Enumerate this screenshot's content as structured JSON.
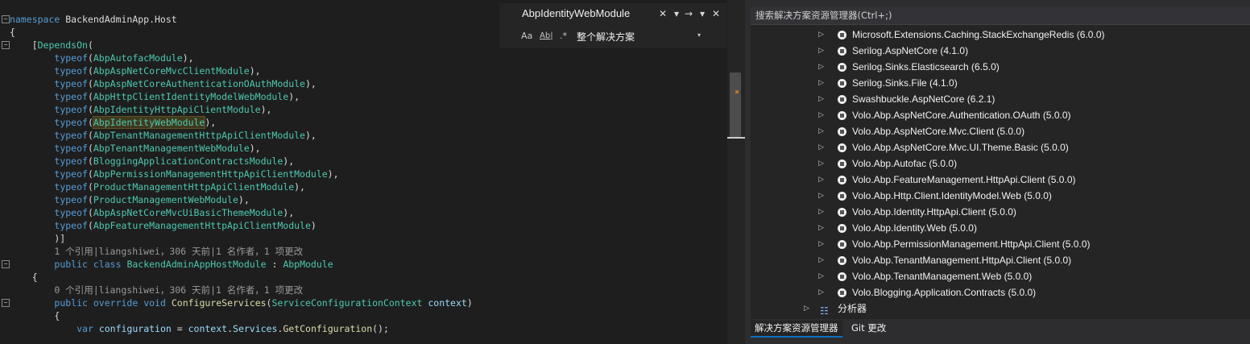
{
  "editor": {
    "lines": [
      [
        {
          "t": "namespace",
          "c": "kw"
        },
        {
          "t": " BackendAdminApp.Host",
          "c": ""
        }
      ],
      [
        {
          "t": "{",
          "c": ""
        }
      ],
      [
        {
          "t": "    [",
          "c": ""
        },
        {
          "t": "DependsOn",
          "c": "attr"
        },
        {
          "t": "(",
          "c": ""
        }
      ],
      [
        {
          "t": "        ",
          "c": ""
        },
        {
          "t": "typeof",
          "c": "kw"
        },
        {
          "t": "(",
          "c": ""
        },
        {
          "t": "AbpAutofacModule",
          "c": "ty"
        },
        {
          "t": "),",
          "c": ""
        }
      ],
      [
        {
          "t": "        ",
          "c": ""
        },
        {
          "t": "typeof",
          "c": "kw"
        },
        {
          "t": "(",
          "c": ""
        },
        {
          "t": "AbpAspNetCoreMvcClientModule",
          "c": "ty"
        },
        {
          "t": "),",
          "c": ""
        }
      ],
      [
        {
          "t": "        ",
          "c": ""
        },
        {
          "t": "typeof",
          "c": "kw"
        },
        {
          "t": "(",
          "c": ""
        },
        {
          "t": "AbpAspNetCoreAuthenticationOAuthModule",
          "c": "ty"
        },
        {
          "t": "),",
          "c": ""
        }
      ],
      [
        {
          "t": "        ",
          "c": ""
        },
        {
          "t": "typeof",
          "c": "kw"
        },
        {
          "t": "(",
          "c": ""
        },
        {
          "t": "AbpHttpClientIdentityModelWebModule",
          "c": "ty"
        },
        {
          "t": "),",
          "c": ""
        }
      ],
      [
        {
          "t": "        ",
          "c": ""
        },
        {
          "t": "typeof",
          "c": "kw"
        },
        {
          "t": "(",
          "c": ""
        },
        {
          "t": "AbpIdentityHttpApiClientModule",
          "c": "ty"
        },
        {
          "t": "),",
          "c": ""
        }
      ],
      [
        {
          "t": "        ",
          "c": ""
        },
        {
          "t": "typeof",
          "c": "kw"
        },
        {
          "t": "(",
          "c": ""
        },
        {
          "t": "AbpIdentityWebModule",
          "c": "ty hl"
        },
        {
          "t": "),",
          "c": ""
        }
      ],
      [
        {
          "t": "        ",
          "c": ""
        },
        {
          "t": "typeof",
          "c": "kw"
        },
        {
          "t": "(",
          "c": ""
        },
        {
          "t": "AbpTenantManagementHttpApiClientModule",
          "c": "ty"
        },
        {
          "t": "),",
          "c": ""
        }
      ],
      [
        {
          "t": "        ",
          "c": ""
        },
        {
          "t": "typeof",
          "c": "kw"
        },
        {
          "t": "(",
          "c": ""
        },
        {
          "t": "AbpTenantManagementWebModule",
          "c": "ty"
        },
        {
          "t": "),",
          "c": ""
        }
      ],
      [
        {
          "t": "        ",
          "c": ""
        },
        {
          "t": "typeof",
          "c": "kw"
        },
        {
          "t": "(",
          "c": ""
        },
        {
          "t": "BloggingApplicationContractsModule",
          "c": "ty"
        },
        {
          "t": "),",
          "c": ""
        }
      ],
      [
        {
          "t": "        ",
          "c": ""
        },
        {
          "t": "typeof",
          "c": "kw"
        },
        {
          "t": "(",
          "c": ""
        },
        {
          "t": "AbpPermissionManagementHttpApiClientModule",
          "c": "ty"
        },
        {
          "t": "),",
          "c": ""
        }
      ],
      [
        {
          "t": "        ",
          "c": ""
        },
        {
          "t": "typeof",
          "c": "kw"
        },
        {
          "t": "(",
          "c": ""
        },
        {
          "t": "ProductManagementHttpApiClientModule",
          "c": "ty"
        },
        {
          "t": "),",
          "c": ""
        }
      ],
      [
        {
          "t": "        ",
          "c": ""
        },
        {
          "t": "typeof",
          "c": "kw"
        },
        {
          "t": "(",
          "c": ""
        },
        {
          "t": "ProductManagementWebModule",
          "c": "ty"
        },
        {
          "t": "),",
          "c": ""
        }
      ],
      [
        {
          "t": "        ",
          "c": ""
        },
        {
          "t": "typeof",
          "c": "kw"
        },
        {
          "t": "(",
          "c": ""
        },
        {
          "t": "AbpAspNetCoreMvcUiBasicThemeModule",
          "c": "ty"
        },
        {
          "t": "),",
          "c": ""
        }
      ],
      [
        {
          "t": "        ",
          "c": ""
        },
        {
          "t": "typeof",
          "c": "kw"
        },
        {
          "t": "(",
          "c": ""
        },
        {
          "t": "AbpFeatureManagementHttpApiClientModule",
          "c": "ty"
        },
        {
          "t": ")",
          "c": ""
        }
      ],
      [
        {
          "t": "        )]",
          "c": ""
        }
      ],
      [
        {
          "t": "        1 个引用|liangshiwei，306 天前|1 名作者，1 项更改",
          "c": "lens"
        }
      ],
      [
        {
          "t": "        ",
          "c": ""
        },
        {
          "t": "public",
          "c": "kw"
        },
        {
          "t": " ",
          "c": ""
        },
        {
          "t": "class",
          "c": "kw"
        },
        {
          "t": " ",
          "c": ""
        },
        {
          "t": "BackendAdminAppHostModule",
          "c": "ty"
        },
        {
          "t": " : ",
          "c": ""
        },
        {
          "t": "AbpModule",
          "c": "ty"
        }
      ],
      [
        {
          "t": "    {",
          "c": ""
        }
      ],
      [
        {
          "t": "        0 个引用|liangshiwei，306 天前|1 名作者，1 项更改",
          "c": "lens"
        }
      ],
      [
        {
          "t": "        ",
          "c": ""
        },
        {
          "t": "public",
          "c": "kw"
        },
        {
          "t": " ",
          "c": ""
        },
        {
          "t": "override",
          "c": "kw"
        },
        {
          "t": " ",
          "c": ""
        },
        {
          "t": "void",
          "c": "kw"
        },
        {
          "t": " ",
          "c": ""
        },
        {
          "t": "ConfigureServices",
          "c": "fn"
        },
        {
          "t": "(",
          "c": ""
        },
        {
          "t": "ServiceConfigurationContext",
          "c": "ty"
        },
        {
          "t": " ",
          "c": ""
        },
        {
          "t": "context",
          "c": "id"
        },
        {
          "t": ")",
          "c": ""
        }
      ],
      [
        {
          "t": "        {",
          "c": ""
        }
      ],
      [
        {
          "t": "            ",
          "c": ""
        },
        {
          "t": "var",
          "c": "kw"
        },
        {
          "t": " ",
          "c": ""
        },
        {
          "t": "configuration",
          "c": "id"
        },
        {
          "t": " = ",
          "c": ""
        },
        {
          "t": "context",
          "c": "id"
        },
        {
          "t": ".",
          "c": ""
        },
        {
          "t": "Services",
          "c": "id"
        },
        {
          "t": ".",
          "c": ""
        },
        {
          "t": "GetConfiguration",
          "c": "fn"
        },
        {
          "t": "();",
          "c": ""
        }
      ]
    ]
  },
  "find": {
    "query": "AbpIdentityWebModule",
    "scope": "整个解决方案",
    "match_case": "Aa",
    "whole_word": "Ab|",
    "regex": ".*"
  },
  "solution_explorer": {
    "search_placeholder": "搜索解决方案资源管理器(Ctrl+;)",
    "packages": [
      "Microsoft.Extensions.Caching.StackExchangeRedis (6.0.0)",
      "Serilog.AspNetCore (4.1.0)",
      "Serilog.Sinks.Elasticsearch (6.5.0)",
      "Serilog.Sinks.File (4.1.0)",
      "Swashbuckle.AspNetCore (6.2.1)",
      "Volo.Abp.AspNetCore.Authentication.OAuth (5.0.0)",
      "Volo.Abp.AspNetCore.Mvc.Client (5.0.0)",
      "Volo.Abp.AspNetCore.Mvc.UI.Theme.Basic (5.0.0)",
      "Volo.Abp.Autofac (5.0.0)",
      "Volo.Abp.FeatureManagement.HttpApi.Client (5.0.0)",
      "Volo.Abp.Http.Client.IdentityModel.Web (5.0.0)",
      "Volo.Abp.Identity.HttpApi.Client (5.0.0)",
      "Volo.Abp.Identity.Web (5.0.0)",
      "Volo.Abp.PermissionManagement.HttpApi.Client (5.0.0)",
      "Volo.Abp.TenantManagement.HttpApi.Client (5.0.0)",
      "Volo.Abp.TenantManagement.Web (5.0.0)",
      "Volo.Blogging.Application.Contracts (5.0.0)"
    ],
    "analyzer_label": "分析器",
    "tabs": [
      "解决方案资源管理器",
      "Git 更改"
    ]
  },
  "icons": {
    "tree_collapsed": "▷",
    "close": "✕",
    "dropdown": "▾",
    "next": "→"
  }
}
